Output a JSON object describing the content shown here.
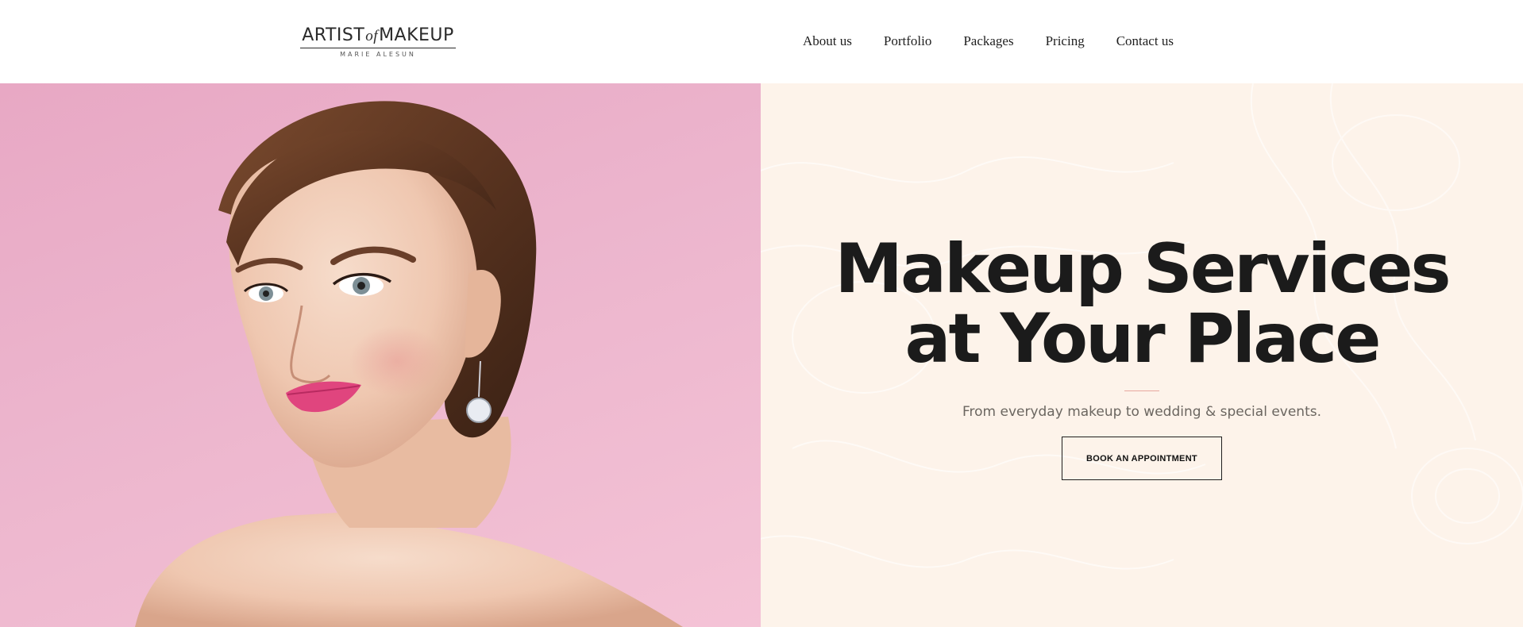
{
  "brand": {
    "logo_main_left": "ARTIST",
    "logo_main_of": "of",
    "logo_main_right": "MAKEUP",
    "logo_sub": "MARIE ALESUN"
  },
  "nav": {
    "items": [
      {
        "label": "About us"
      },
      {
        "label": "Portfolio"
      },
      {
        "label": "Packages"
      },
      {
        "label": "Pricing"
      },
      {
        "label": "Contact us"
      }
    ]
  },
  "hero": {
    "title_line1": "Makeup Services",
    "title_line2": "at Your Place",
    "subtitle": "From everyday makeup to wedding & special events.",
    "cta_label": "BOOK AN APPOINTMENT",
    "image_description_icon": "model-portrait-photo"
  },
  "colors": {
    "image_background": "#ecb5cd",
    "panel_background": "#fdf3ea",
    "divider_accent": "#e8a8a0",
    "text_dark": "#1b1b1b"
  }
}
